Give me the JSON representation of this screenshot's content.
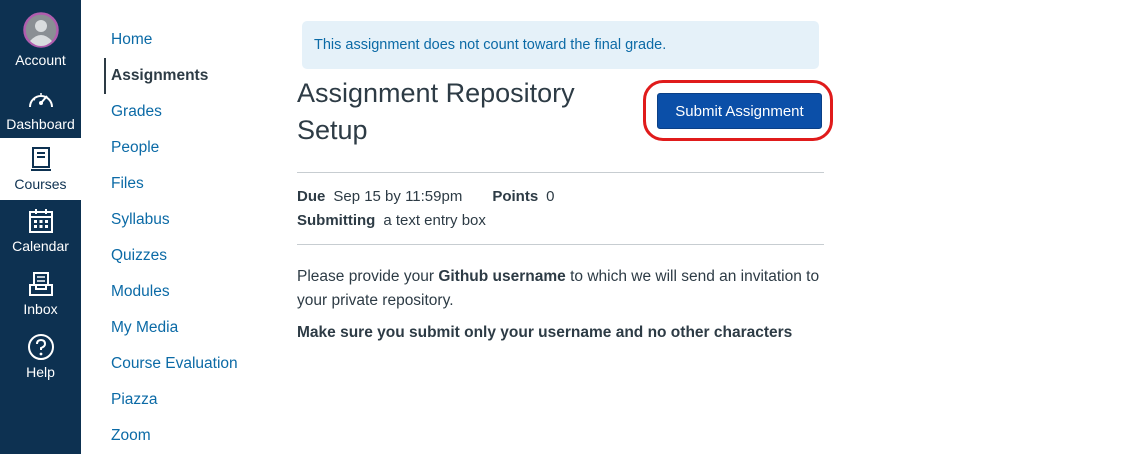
{
  "global_nav": {
    "items": [
      {
        "label": "Account",
        "icon": "avatar-icon"
      },
      {
        "label": "Dashboard",
        "icon": "dashboard-icon"
      },
      {
        "label": "Courses",
        "icon": "courses-icon"
      },
      {
        "label": "Calendar",
        "icon": "calendar-icon"
      },
      {
        "label": "Inbox",
        "icon": "inbox-icon"
      },
      {
        "label": "Help",
        "icon": "help-icon"
      }
    ]
  },
  "course_nav": {
    "items": [
      {
        "label": "Home"
      },
      {
        "label": "Assignments"
      },
      {
        "label": "Grades"
      },
      {
        "label": "People"
      },
      {
        "label": "Files"
      },
      {
        "label": "Syllabus"
      },
      {
        "label": "Quizzes"
      },
      {
        "label": "Modules"
      },
      {
        "label": "My Media"
      },
      {
        "label": "Course Evaluation"
      },
      {
        "label": "Piazza"
      },
      {
        "label": "Zoom"
      }
    ],
    "active": "Assignments"
  },
  "assignment": {
    "notice": "This assignment does not count toward the final grade.",
    "title": "Assignment Repository Setup",
    "submit_label": "Submit Assignment",
    "due_label": "Due",
    "due_value": "Sep 15 by 11:59pm",
    "points_label": "Points",
    "points_value": "0",
    "submitting_label": "Submitting",
    "submitting_value": "a text entry box",
    "description_before": "Please provide your ",
    "description_bold": "Github username",
    "description_after": " to which we will send an invitation to your private repository.",
    "description_note": "Make sure you submit only your username and no other characters"
  },
  "colors": {
    "nav_bg": "#0d3151",
    "link": "#0b6aa6",
    "button": "#0b4fa8",
    "highlight": "#e01b1b",
    "notice_bg": "#e5f1f9"
  }
}
